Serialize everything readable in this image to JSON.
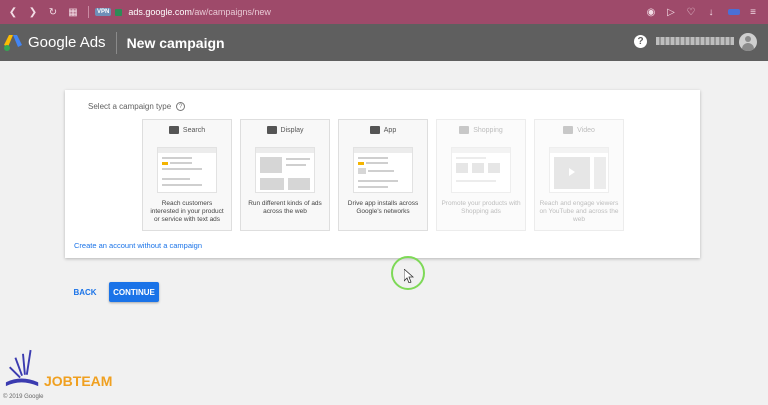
{
  "browser": {
    "vpn_badge": "VPN",
    "url_host": "ads.google.com",
    "url_path": "/aw/campaigns/new",
    "bar_color": "#9e4a6a"
  },
  "header": {
    "brand": "Google Ads",
    "page_title": "New campaign",
    "help_label": "?"
  },
  "card": {
    "select_label": "Select a campaign type",
    "help_mark": "?",
    "tiles": [
      {
        "name": "Search",
        "icon": "search-icon",
        "desc": "Reach customers interested in your product or service with text ads",
        "enabled": true
      },
      {
        "name": "Display",
        "icon": "display-icon",
        "desc": "Run different kinds of ads across the web",
        "enabled": true
      },
      {
        "name": "App",
        "icon": "app-icon",
        "desc": "Drive app installs across Google's networks",
        "enabled": true
      },
      {
        "name": "Shopping",
        "icon": "shopping-icon",
        "desc": "Promote your products with Shopping ads",
        "enabled": false
      },
      {
        "name": "Video",
        "icon": "video-icon",
        "desc": "Reach and engage viewers on YouTube and across the web",
        "enabled": false
      }
    ],
    "no_campaign_link": "Create an account without a campaign"
  },
  "buttons": {
    "back": "BACK",
    "continue": "CONTINUE"
  },
  "watermark": {
    "brand": "JOBTEAM",
    "accent": "#f0a020"
  },
  "footer": {
    "copyright": "© 2019 Google"
  },
  "colors": {
    "primary": "#1a73e8",
    "header_bg": "#5f5f5f",
    "cursor_ring": "#7ed957"
  }
}
